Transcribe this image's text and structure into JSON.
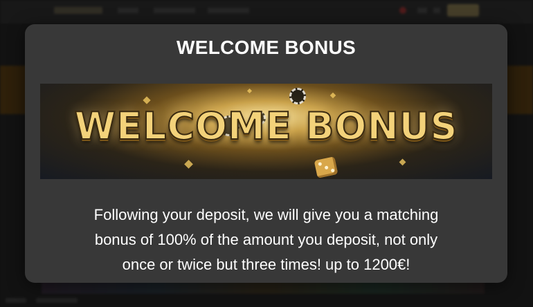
{
  "modal": {
    "title": "WELCOME BONUS",
    "banner": {
      "headline": "WELCOME BONUS"
    },
    "description_line1": "Following your deposit, we will give you a matching",
    "description_line2": "bonus of 100% of the amount you deposit, not only",
    "description_line3": "once or twice but three times!  up to 1200€!"
  },
  "colors": {
    "modal_background": "#383838",
    "title_text": "#ffffff",
    "banner_gold": "#f3d27a",
    "page_background": "#1a1a1a"
  }
}
